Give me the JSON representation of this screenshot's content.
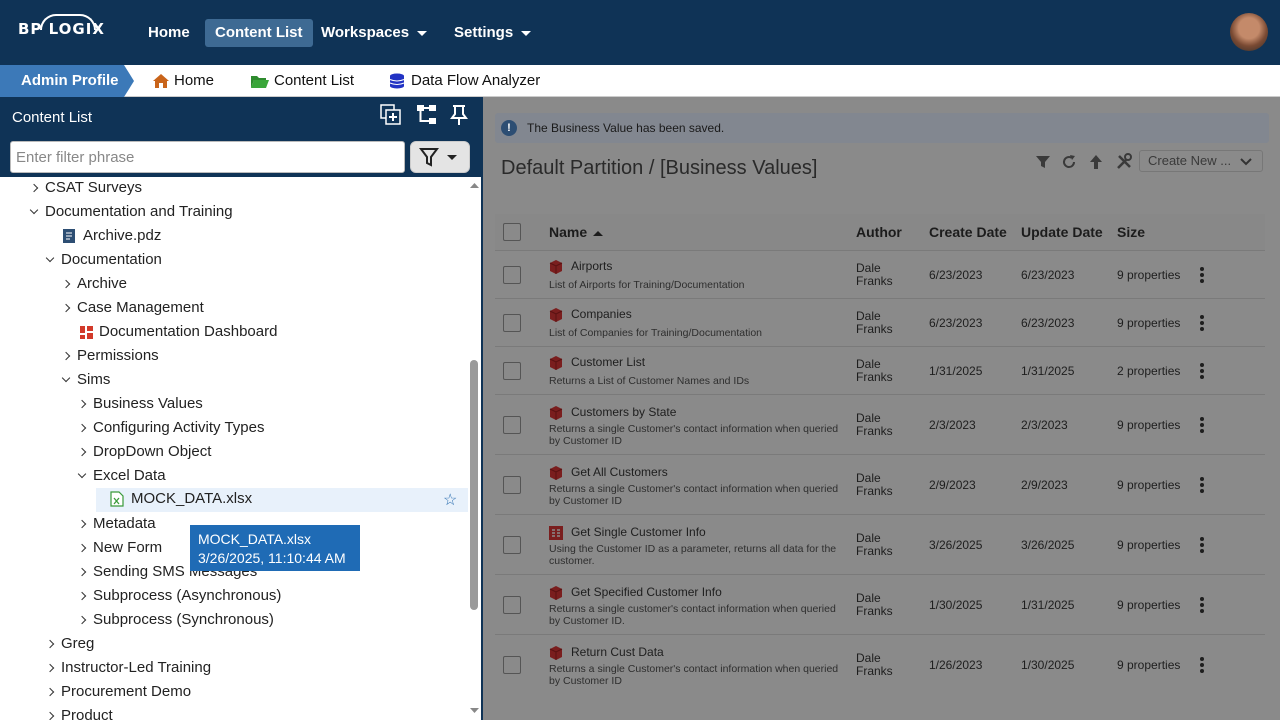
{
  "app": {
    "logo_text": "BP LOGIX",
    "nav": [
      {
        "label": "Home"
      },
      {
        "label": "Content List"
      },
      {
        "label": "Workspaces"
      },
      {
        "label": "Settings"
      }
    ]
  },
  "breadcrumb": {
    "profile": "Admin Profile",
    "items": [
      {
        "label": "Home",
        "icon": "home-icon"
      },
      {
        "label": "Content List",
        "icon": "folder-open-icon"
      },
      {
        "label": "Data Flow Analyzer",
        "icon": "database-icon"
      }
    ]
  },
  "left": {
    "title": "Content List",
    "filter_placeholder": "Enter filter phrase",
    "tree": [
      {
        "label": "CSAT Surveys",
        "state": "collapsed"
      },
      {
        "label": "Documentation and Training",
        "state": "expanded"
      },
      {
        "label": "Archive.pdz",
        "state": "leaf",
        "icon": "document-icon"
      },
      {
        "label": "Documentation",
        "state": "expanded"
      },
      {
        "label": "Archive",
        "state": "collapsed"
      },
      {
        "label": "Case Management",
        "state": "collapsed"
      },
      {
        "label": "Documentation Dashboard",
        "state": "leaf",
        "icon": "dashboard-icon"
      },
      {
        "label": "Permissions",
        "state": "collapsed"
      },
      {
        "label": "Sims",
        "state": "expanded"
      },
      {
        "label": "Business Values",
        "state": "collapsed"
      },
      {
        "label": "Configuring Activity Types",
        "state": "collapsed"
      },
      {
        "label": "DropDown Object",
        "state": "collapsed"
      },
      {
        "label": "Excel Data",
        "state": "expanded"
      },
      {
        "label": "MOCK_DATA.xlsx",
        "state": "leaf",
        "icon": "excel-icon",
        "selected": true
      },
      {
        "label": "Metadata",
        "state": "collapsed"
      },
      {
        "label": "New Form",
        "state": "collapsed"
      },
      {
        "label": "Sending SMS Messages",
        "state": "collapsed"
      },
      {
        "label": "Subprocess (Asynchronous)",
        "state": "collapsed"
      },
      {
        "label": "Subprocess (Synchronous)",
        "state": "collapsed"
      },
      {
        "label": "Greg",
        "state": "collapsed"
      },
      {
        "label": "Instructor-Led Training",
        "state": "collapsed"
      },
      {
        "label": "Procurement Demo",
        "state": "collapsed"
      },
      {
        "label": "Product",
        "state": "collapsed"
      }
    ],
    "tooltip": {
      "line1": "MOCK_DATA.xlsx",
      "line2": "3/26/2025, 11:10:44 AM"
    }
  },
  "right": {
    "notice": "The Business Value has been saved.",
    "title": "Default Partition / [Business Values]",
    "create_new": "Create New ...",
    "columns": {
      "name": "Name",
      "author": "Author",
      "create": "Create Date",
      "update": "Update Date",
      "size": "Size"
    },
    "rows": [
      {
        "name": "Airports",
        "desc": "List of Airports for Training/Documentation",
        "author": "Dale Franks",
        "create": "6/23/2023",
        "update": "6/23/2023",
        "size": "9 properties",
        "icon": "cube-icon"
      },
      {
        "name": "Companies",
        "desc": "List of Companies for Training/Documentation",
        "author": "Dale Franks",
        "create": "6/23/2023",
        "update": "6/23/2023",
        "size": "9 properties",
        "icon": "cube-icon"
      },
      {
        "name": "Customer List",
        "desc": "Returns a List of Customer Names and IDs",
        "author": "Dale Franks",
        "create": "1/31/2025",
        "update": "1/31/2025",
        "size": "2 properties",
        "icon": "cube-icon"
      },
      {
        "name": "Customers by State",
        "desc": "Returns a single Customer's contact information when queried by Customer ID",
        "author": "Dale Franks",
        "create": "2/3/2023",
        "update": "2/3/2023",
        "size": "9 properties",
        "icon": "cube-icon"
      },
      {
        "name": "Get All Customers",
        "desc": "Returns a single Customer's contact information when queried by Customer ID",
        "author": "Dale Franks",
        "create": "2/9/2023",
        "update": "2/9/2023",
        "size": "9 properties",
        "icon": "cube-icon"
      },
      {
        "name": "Get Single Customer Info",
        "desc": "Using the Customer ID as a parameter, returns all data for the customer.",
        "author": "Dale Franks",
        "create": "3/26/2025",
        "update": "3/26/2025",
        "size": "9 properties",
        "icon": "table-icon"
      },
      {
        "name": "Get Specified Customer Info",
        "desc": "Returns a single customer's contact information when queried by Customer ID.",
        "author": "Dale Franks",
        "create": "1/30/2025",
        "update": "1/31/2025",
        "size": "9 properties",
        "icon": "cube-icon"
      },
      {
        "name": "Return Cust Data",
        "desc": "Returns a single Customer's contact information when queried by Customer ID",
        "author": "Dale Franks",
        "create": "1/26/2023",
        "update": "1/30/2025",
        "size": "9 properties",
        "icon": "cube-icon"
      }
    ]
  }
}
